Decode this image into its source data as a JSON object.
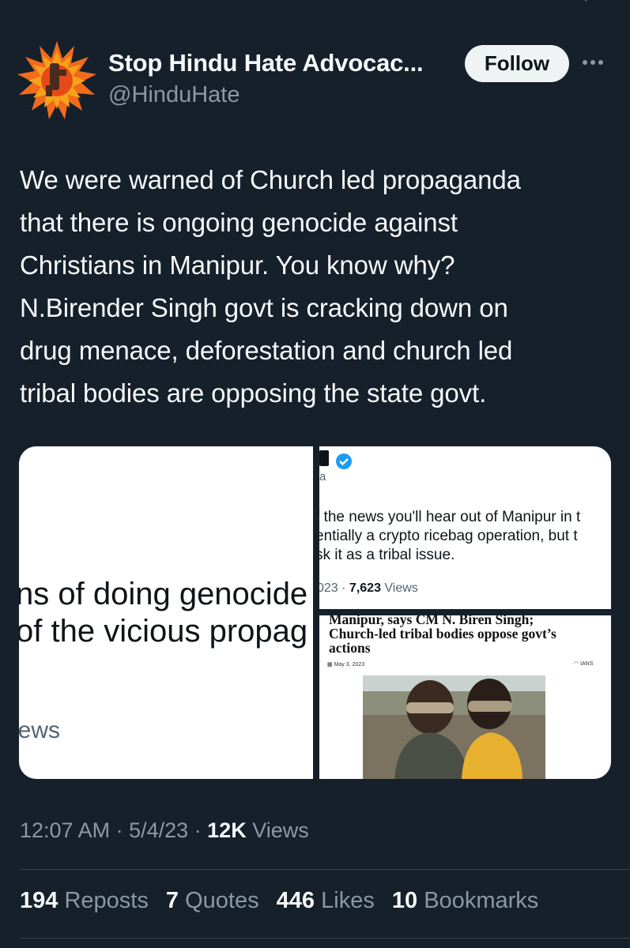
{
  "tweet": {
    "author_name": "Stop Hindu Hate Advocac...",
    "handle": "@HinduHate",
    "follow_label": "Follow",
    "text": "We were warned of Church led propaganda\nthat there is ongoing genocide against\nChristians in Manipur. You know why?\nN.Birender Singh govt is cracking down on\ndrug menace, deforestation and church led\ntribal bodies are opposing the state govt."
  },
  "media": {
    "left": {
      "line1": "ns of doing genocide",
      "line2": "of the vicious propag",
      "views": "iews"
    },
    "top_right": {
      "sub": "a",
      "text": "f the news you'll hear out of Manipur in t\nentially a crypto ricebag operation, but t\nsk it as a tribal issue.",
      "date": "023 · ",
      "views_count": "7,623",
      "views_label": " Views"
    },
    "bottom_right": {
      "headline": "Manipur, says CM N. Biren Singh;\nChurch-led tribal bodies oppose govt’s\nactions",
      "date": "May 3, 2023",
      "source": "IANS"
    }
  },
  "meta": {
    "time": "12:07 AM",
    "sep1": " · ",
    "date": "5/4/23",
    "sep2": " · ",
    "views_count": "12K",
    "views_label": " Views"
  },
  "stats": [
    {
      "count": "194",
      "label": " Reposts"
    },
    {
      "count": "7",
      "label": " Quotes"
    },
    {
      "count": "446",
      "label": " Likes"
    },
    {
      "count": "10",
      "label": " Bookmarks"
    }
  ],
  "colors": {
    "background": "#15202b",
    "text": "#f7f9f9",
    "secondary": "#8b98a5",
    "verified": "#1d9bf0"
  }
}
